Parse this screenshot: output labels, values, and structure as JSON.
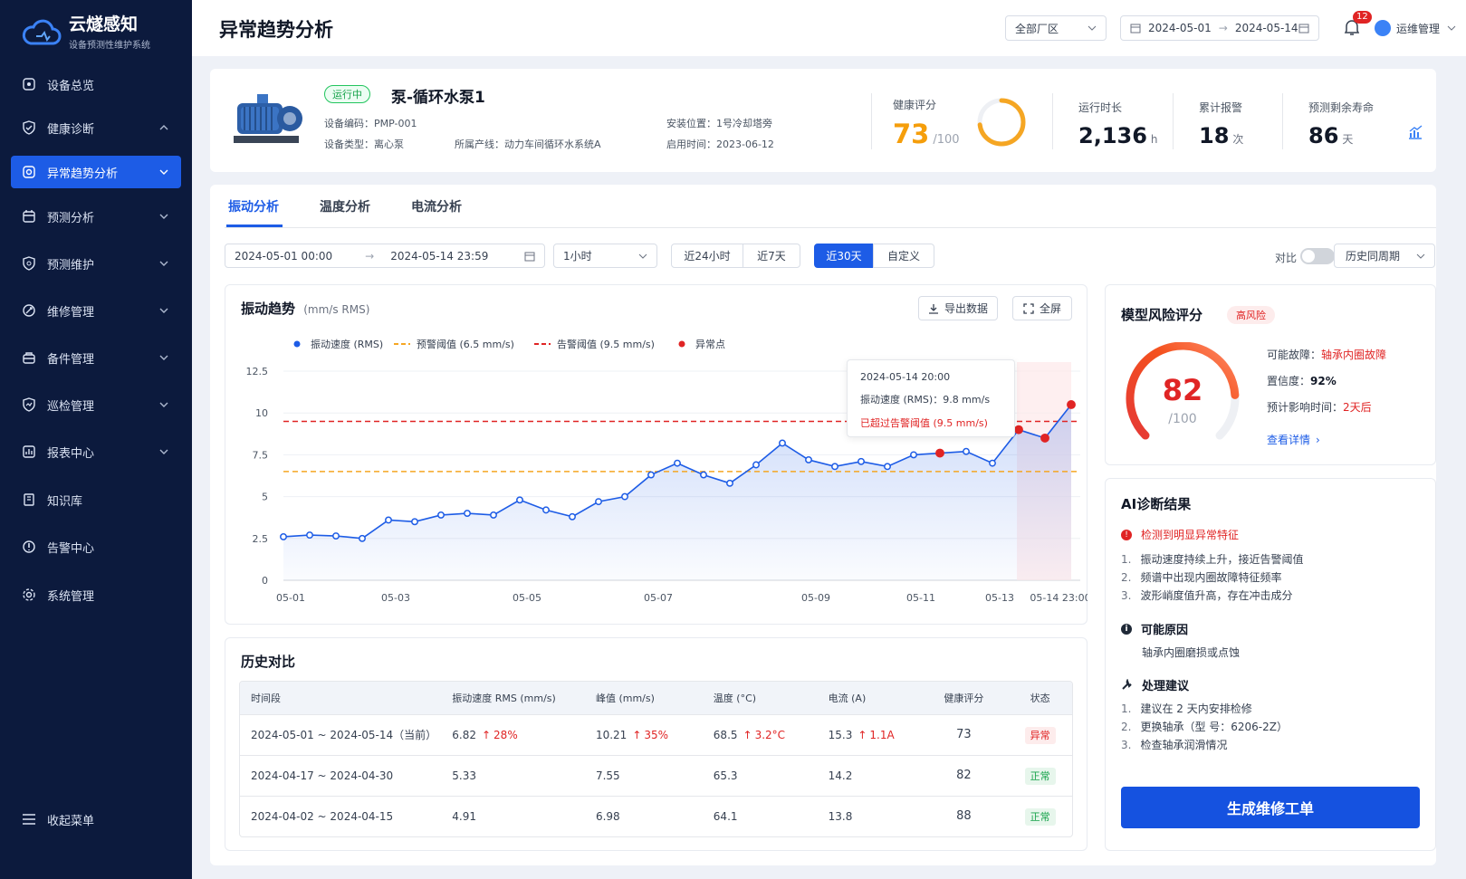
{
  "brand": {
    "name": "云燧感知",
    "subtitle": "设备预测性维护系统"
  },
  "sidebar": {
    "items": [
      {
        "label": "设备总览",
        "icon": "dashboard-icon",
        "chevron": ""
      },
      {
        "label": "健康诊断",
        "icon": "shield-check-icon",
        "chevron": "up"
      },
      {
        "label": "异常趋势分析",
        "icon": "target-icon",
        "chevron": "down",
        "active": true
      },
      {
        "label": "预测分析",
        "icon": "calendar-icon",
        "chevron": "down"
      },
      {
        "label": "预测维护",
        "icon": "shield-icon",
        "chevron": "down"
      },
      {
        "label": "维修管理",
        "icon": "wrench-icon",
        "chevron": "down"
      },
      {
        "label": "备件管理",
        "icon": "box-icon",
        "chevron": "down"
      },
      {
        "label": "巡检管理",
        "icon": "inspect-icon",
        "chevron": "down"
      },
      {
        "label": "报表中心",
        "icon": "report-icon",
        "chevron": "down"
      },
      {
        "label": "知识库",
        "icon": "book-icon",
        "chevron": ""
      },
      {
        "label": "告警中心",
        "icon": "alert-icon",
        "chevron": ""
      },
      {
        "label": "系统管理",
        "icon": "gear-icon",
        "chevron": ""
      }
    ],
    "collapse_label": "收起菜单"
  },
  "header": {
    "title": "异常趋势分析",
    "plant_select": "全部厂区",
    "date_start": "2024-05-01",
    "date_end": "2024-05-14",
    "notification_count": "12",
    "user": "运维管理"
  },
  "device": {
    "status": "运行中",
    "name": "泵-循环水泵1",
    "code_label": "设备编码：",
    "code": "PMP-001",
    "location_label": "安装位置：",
    "location": "1号冷却塔旁",
    "type_label": "设备类型：",
    "type": "离心泵",
    "line_label": "所属产线：",
    "line": "动力车间循环水系统A",
    "start_label": "启用时间：",
    "start": "2023-06-12",
    "health_label": "健康评分",
    "health_score": "73",
    "health_max": "/100",
    "health_fraction": 0.73,
    "runtime_label": "运行时长",
    "runtime": "2,136",
    "runtime_unit": "h",
    "alarms_label": "累计报警",
    "alarms": "18",
    "alarms_unit": "次",
    "rul_label": "预测剩余寿命",
    "rul": "86",
    "rul_unit": "天"
  },
  "tabs": [
    "振动分析",
    "温度分析",
    "电流分析"
  ],
  "filters": {
    "range_start": "2024-05-01 00:00",
    "range_end": "2024-05-14 23:59",
    "interval": "1小时",
    "quick": [
      "近24小时",
      "近7天",
      "近30天",
      "自定义"
    ],
    "compare_label": "对比",
    "compare_option": "历史同周期"
  },
  "chart": {
    "title": "振动趋势",
    "unit": "(mm/s RMS)",
    "export_label": "导出数据",
    "fullscreen_label": "全屏",
    "tooltip": {
      "time": "2024-05-14 20:00",
      "value": "振动速度 (RMS)：9.8 mm/s",
      "warning": "已超过告警阈值 (9.5 mm/s)"
    }
  },
  "chart_data": {
    "type": "line",
    "title": "振动趋势",
    "ylabel": "(mm/s RMS)",
    "ylim": [
      0,
      12.5
    ],
    "yticks": [
      "0",
      "2.5",
      "5",
      "7.5",
      "10",
      "12.5"
    ],
    "xticks": [
      "05-01",
      "05-03",
      "05-05",
      "05-07",
      "05-09",
      "05-11",
      "05-13",
      "05-14 23:00"
    ],
    "legend": [
      "振动速度 (RMS)",
      "预警阈值 (6.5 mm/s)",
      "告警阈值 (9.5 mm/s)",
      "异常点"
    ],
    "warning_threshold": 6.5,
    "alarm_threshold": 9.5,
    "series": [
      {
        "name": "振动速度 (RMS)",
        "values": [
          2.6,
          2.7,
          2.65,
          2.5,
          3.6,
          3.5,
          3.9,
          4.0,
          3.9,
          4.8,
          4.2,
          3.8,
          4.7,
          5.0,
          6.3,
          7.0,
          6.3,
          5.8,
          6.9,
          8.2,
          7.2,
          6.8,
          7.1,
          6.8,
          7.5,
          7.6,
          7.7,
          7.0,
          9.0,
          8.5,
          10.5
        ]
      },
      {
        "name": "异常点",
        "indices": [
          25,
          28,
          29,
          30
        ]
      }
    ]
  },
  "history": {
    "title": "历史对比",
    "columns": [
      "时间段",
      "振动速度 RMS (mm/s)",
      "峰值 (mm/s)",
      "温度 (°C)",
      "电流 (A)",
      "健康评分",
      "状态"
    ],
    "rows": [
      {
        "period": "2024-05-01 ~ 2024-05-14（当前）",
        "rms": "6.82",
        "rms_delta": "28%",
        "peak": "10.21",
        "peak_delta": "35%",
        "temp": "68.5",
        "temp_delta": "3.2°C",
        "current": "15.3",
        "current_delta": "1.1A",
        "score": "73",
        "status": "异常",
        "status_type": "bad"
      },
      {
        "period": "2024-04-17 ~ 2024-04-30",
        "rms": "5.33",
        "rms_delta": "",
        "peak": "7.55",
        "peak_delta": "",
        "temp": "65.3",
        "temp_delta": "",
        "current": "14.2",
        "current_delta": "",
        "score": "82",
        "status": "正常",
        "status_type": "ok"
      },
      {
        "period": "2024-04-02 ~ 2024-04-15",
        "rms": "4.91",
        "rms_delta": "",
        "peak": "6.98",
        "peak_delta": "",
        "temp": "64.1",
        "temp_delta": "",
        "current": "13.8",
        "current_delta": "",
        "score": "88",
        "status": "正常",
        "status_type": "ok"
      }
    ]
  },
  "risk": {
    "title": "模型风险评分",
    "badge": "高风险",
    "score": "82",
    "max": "/100",
    "fraction": 0.82,
    "fault_label": "可能故障：",
    "fault": "轴承内圈故障",
    "confidence_label": "置信度：",
    "confidence": "92%",
    "impact_label": "预计影响时间：",
    "impact": "2天后",
    "details_link": "查看详情"
  },
  "ai": {
    "title": "AI诊断结果",
    "detected": "检测到明显异常特征",
    "findings": [
      "振动速度持续上升，接近告警阈值",
      "频谱中出现内圈故障特征频率",
      "波形峭度值升高，存在冲击成分"
    ],
    "cause_title": "可能原因",
    "cause": "轴承内圈磨损或点蚀",
    "advice_title": "处理建议",
    "advice": [
      "建议在 2 天内安排检修",
      "更换轴承（型 号：6206-2Z）",
      "检查轴承润滑情况"
    ],
    "button": "生成维修工单"
  },
  "colors": {
    "primary": "#1d5ce6",
    "sidebar": "#0c1a3d",
    "warning": "#f5a623",
    "danger": "#e02424",
    "series": "#1d5ce6"
  }
}
